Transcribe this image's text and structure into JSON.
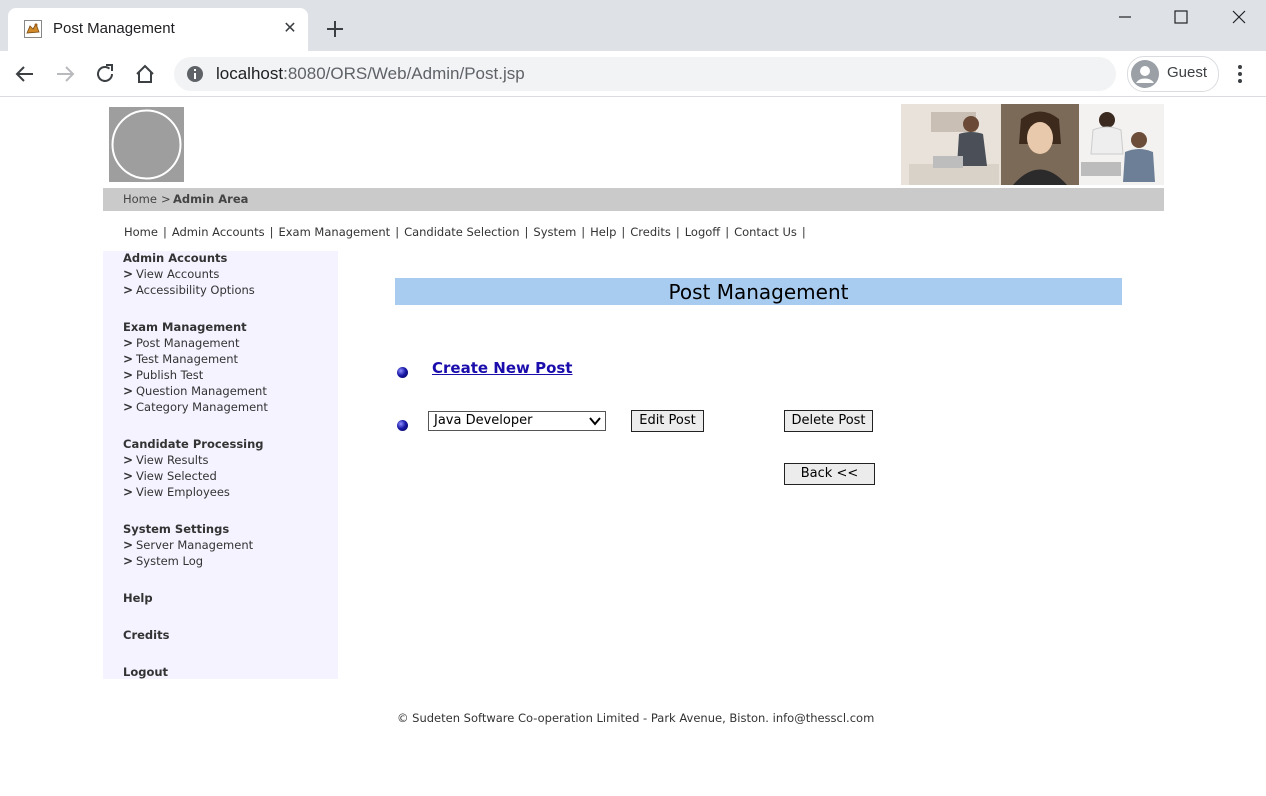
{
  "browser": {
    "tab_title": "Post Management",
    "tab_close_glyph": "✕",
    "url_host": "localhost",
    "url_path": ":8080/ORS/Web/Admin/Post.jsp",
    "profile_label": "Guest"
  },
  "breadcrumb": {
    "home": "Home",
    "separator": ">",
    "current": "Admin Area"
  },
  "topnav": {
    "items": [
      "Home",
      "Admin Accounts",
      "Exam Management",
      "Candidate Selection",
      "System",
      "Help",
      "Credits",
      "Logoff",
      "Contact Us"
    ],
    "separator": "|"
  },
  "sidebar": {
    "sections": [
      {
        "heading": "Admin Accounts",
        "items": [
          "View Accounts",
          "Accessibility Options"
        ]
      },
      {
        "heading": "Exam Management",
        "items": [
          "Post Management",
          "Test Management",
          "Publish Test",
          "Question Management",
          "Category Management"
        ]
      },
      {
        "heading": "Candidate Processing",
        "items": [
          "View Results",
          "View Selected",
          "View Employees"
        ]
      },
      {
        "heading": "System Settings",
        "items": [
          "Server Management",
          "System Log"
        ]
      },
      {
        "heading": "Help",
        "items": []
      },
      {
        "heading": "Credits",
        "items": []
      },
      {
        "heading": "Logout",
        "items": []
      }
    ],
    "chevron_glyph": ">"
  },
  "main": {
    "title": "Post Management",
    "create_link": "Create New Post",
    "post_select_value": "Java Developer",
    "edit_button": "Edit Post",
    "delete_button": "Delete Post",
    "back_button": "Back <<"
  },
  "footer": {
    "text": "© Sudeten Software Co-operation Limited - Park Avenue, Biston. info@thesscl.com"
  },
  "colors": {
    "title_bar": "#a8ccf0",
    "sidebar_bg": "#f5f3ff",
    "breadcrumb_bg": "#cacaca",
    "link": "#1a0dab"
  }
}
